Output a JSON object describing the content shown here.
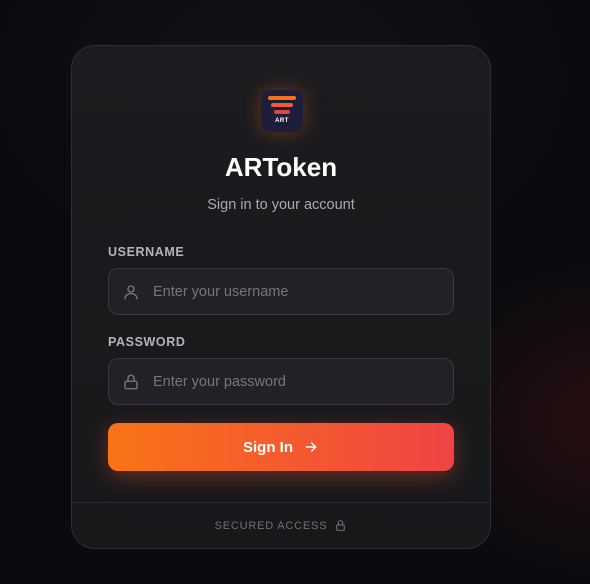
{
  "brand": {
    "logo_text": "ART",
    "title": "ARToken",
    "subtitle": "Sign in to your account"
  },
  "form": {
    "username": {
      "label": "USERNAME",
      "placeholder": "Enter your username",
      "value": "",
      "icon": "user-icon"
    },
    "password": {
      "label": "PASSWORD",
      "placeholder": "Enter your password",
      "value": "",
      "icon": "lock-icon"
    },
    "submit_label": "Sign In",
    "submit_icon": "arrow-right-icon"
  },
  "footer": {
    "text": "SECURED ACCESS",
    "icon": "lock-icon"
  },
  "colors": {
    "background": "#0b0b0f",
    "card": "#1c1c20",
    "accent_start": "#f97316",
    "accent_end": "#ef4444",
    "text_primary": "#ffffff",
    "text_muted": "#a9a9b2"
  }
}
